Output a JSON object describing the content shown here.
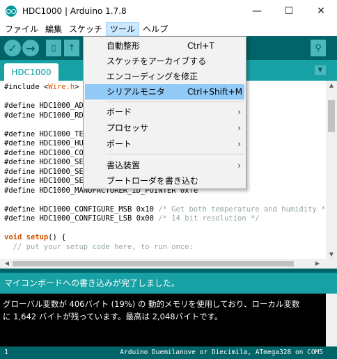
{
  "window": {
    "title": "HDC1000 | Arduino 1.7.8",
    "controls": {
      "minimize": "—",
      "maximize": "☐",
      "close": "✕"
    }
  },
  "menubar": {
    "items": [
      "ファイル",
      "編集",
      "スケッチ",
      "ツール",
      "ヘルプ"
    ],
    "active": "ツール"
  },
  "toolbar": {
    "verify": "✓",
    "upload": "→",
    "new": "▯",
    "open": "↑",
    "save": "↓",
    "serial_monitor": "⚲"
  },
  "tabs": {
    "active_tab": "HDC1000",
    "menu": "▼"
  },
  "editor": {
    "lines": [
      {
        "kind": "include",
        "pre": "#include <",
        "lib": "Wire.h",
        "post": ">"
      },
      {
        "kind": "blank",
        "text": ""
      },
      {
        "kind": "plain",
        "text": "#define HDC1000_ADD"
      },
      {
        "kind": "plain",
        "text": "#define HDC1000_RDY"
      },
      {
        "kind": "blank",
        "text": ""
      },
      {
        "kind": "plain",
        "text": "#define HDC1000_TEM"
      },
      {
        "kind": "plain",
        "text": "#define HDC1000_HUM"
      },
      {
        "kind": "plain",
        "text": "#define HDC1000_CON"
      },
      {
        "kind": "plain",
        "text": "#define HDC1000_SER"
      },
      {
        "kind": "plain",
        "text": "#define HDC1000_SER"
      },
      {
        "kind": "plain",
        "text": "#define HDC1000_SER"
      },
      {
        "kind": "plain",
        "text": "#define HDC1000_MANUFACTURER_ID_POINTER 0xfe"
      },
      {
        "kind": "blank",
        "text": ""
      },
      {
        "kind": "define_cmt",
        "text": "#define HDC1000_CONFIGURE_MSB 0x10 ",
        "comment": "/* Get both temperature and humidity */"
      },
      {
        "kind": "define_cmt",
        "text": "#define HDC1000_CONFIGURE_LSB 0x00 ",
        "comment": "/* 14 bit resolution */"
      },
      {
        "kind": "blank",
        "text": ""
      },
      {
        "kind": "func",
        "type": "void",
        "name": "setup",
        "rest": "() {"
      },
      {
        "kind": "comment",
        "text": "  // put your setup code here, to run once:"
      }
    ]
  },
  "status": {
    "message": "マイコンボードへの書き込みが完了しました。"
  },
  "console": {
    "lines": [
      "グローバル変数が 406バイト (19%) の 動的メモリを使用しており、ローカル変数",
      "に 1,642 バイトが残っています。最高は 2,048バイトです。"
    ]
  },
  "footer": {
    "line_number": "1",
    "board": "Arduino Duemilanove or Diecimila, ATmega328 on COM5"
  },
  "tools_menu": {
    "items": [
      {
        "label": "自動整形",
        "shortcut": "Ctrl+T",
        "submenu": false
      },
      {
        "label": "スケッチをアーカイブする",
        "shortcut": "",
        "submenu": false
      },
      {
        "label": "エンコーディングを修正",
        "shortcut": "",
        "submenu": false
      },
      {
        "label": "シリアルモニタ",
        "shortcut": "Ctrl+Shift+M",
        "submenu": false,
        "highlighted": true
      },
      {
        "label": "ボード",
        "shortcut": "",
        "submenu": true
      },
      {
        "label": "プロセッサ",
        "shortcut": "",
        "submenu": true
      },
      {
        "label": "ポート",
        "shortcut": "",
        "submenu": true
      },
      {
        "label": "書込装置",
        "shortcut": "",
        "submenu": true
      },
      {
        "label": "ブートローダを書き込む",
        "shortcut": "",
        "submenu": false
      }
    ],
    "submenu_arrow": "›"
  },
  "colors": {
    "toolbar": "#006468",
    "accent": "#17a1a5",
    "highlight": "#91c9f7",
    "keyword": "#d35400",
    "comment": "#95a5a6"
  },
  "icons": {
    "app": "arduino-logo-icon",
    "verify": "checkmark-icon",
    "upload": "arrow-right-icon",
    "new": "new-file-icon",
    "open": "open-arrow-up-icon",
    "save": "save-arrow-down-icon",
    "serial_monitor": "magnifier-icon",
    "tab_menu": "triangle-down-icon"
  }
}
